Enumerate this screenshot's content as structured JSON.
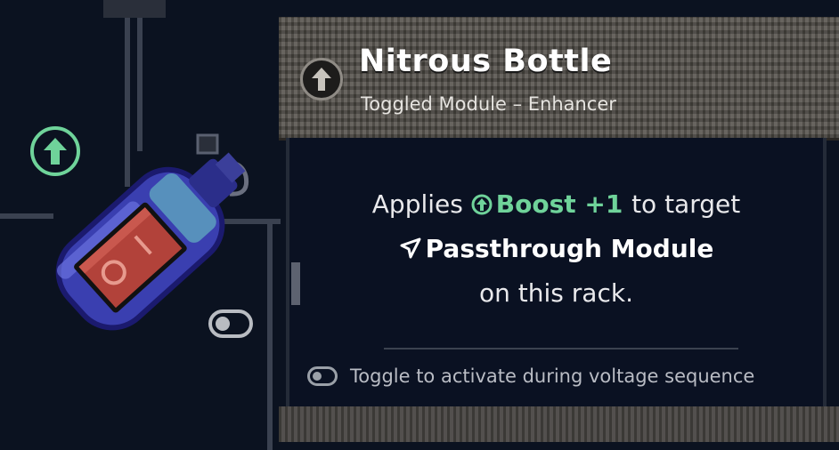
{
  "item": {
    "title": "Nitrous Bottle",
    "subtitle": "Toggled Module – Enhancer",
    "type_icon": "arrow-up-circle-icon"
  },
  "description": {
    "line1_prefix": "Applies",
    "boost_label": "Boost +1",
    "line1_suffix": "to target",
    "target_module": "Passthrough Module",
    "line3": "on this rack."
  },
  "hint": {
    "text": "Toggle to activate during voltage sequence",
    "icon": "toggle-icon"
  },
  "colors": {
    "boost_green": "#6fd39a",
    "bottle_blue": "#3a3fb0",
    "switch_red": "#b2423a",
    "panel_bg": "#0a1122",
    "header_stone": "#5a5650"
  }
}
